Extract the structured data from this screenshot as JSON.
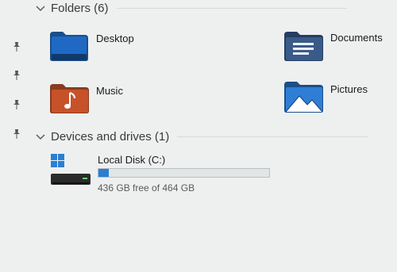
{
  "folders": {
    "title": "Folders (6)",
    "items": [
      {
        "label": "Desktop",
        "icon": "desktop-folder-icon"
      },
      {
        "label": "Documents",
        "icon": "documents-folder-icon"
      },
      {
        "label": "Music",
        "icon": "music-folder-icon"
      },
      {
        "label": "Pictures",
        "icon": "pictures-folder-icon"
      }
    ]
  },
  "drives": {
    "title": "Devices and drives (1)",
    "items": [
      {
        "label": "Local Disk (C:)",
        "free_text": "436 GB free of 464 GB",
        "used_fraction": 0.06
      }
    ]
  },
  "colors": {
    "drive_fill": "#2a7fd3",
    "folder_blue": "#1f69c4"
  }
}
